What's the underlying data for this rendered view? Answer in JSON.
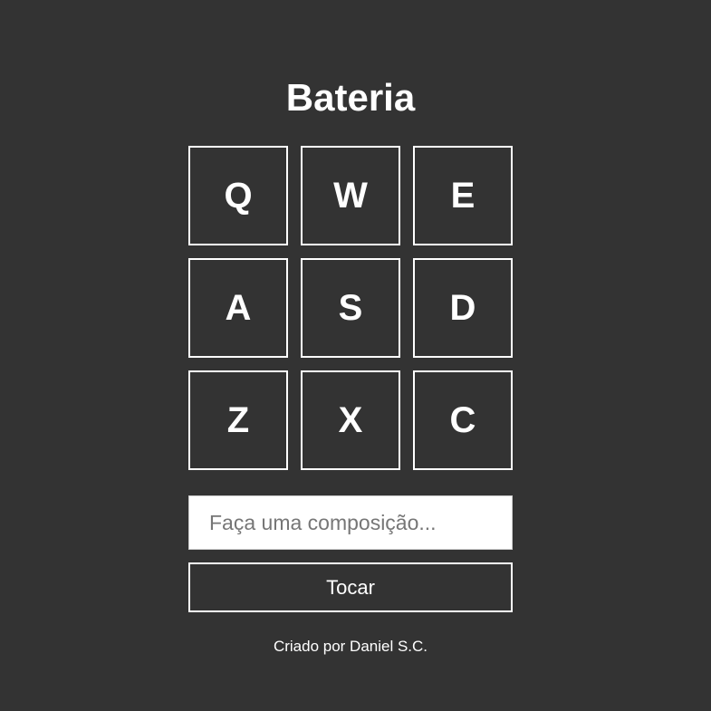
{
  "colors": {
    "background": "#333333",
    "foreground": "#ffffff",
    "input_background": "#ffffff"
  },
  "title": "Bateria",
  "keys": [
    "Q",
    "W",
    "E",
    "A",
    "S",
    "D",
    "Z",
    "X",
    "C"
  ],
  "composition": {
    "value": "",
    "placeholder": "Faça uma composição..."
  },
  "play_button": {
    "label": "Tocar"
  },
  "footer": {
    "credit": "Criado por Daniel S.C."
  }
}
